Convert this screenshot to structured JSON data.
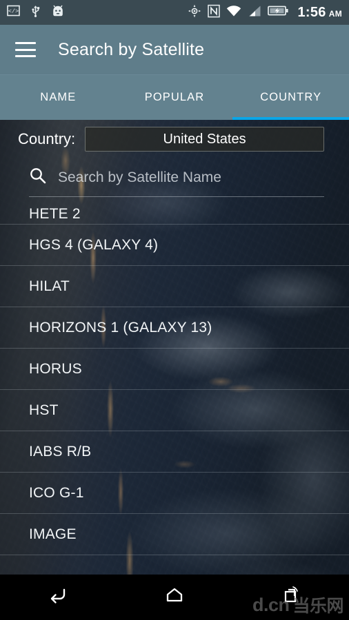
{
  "status_bar": {
    "time": "1:56",
    "ampm": "AM",
    "icons": [
      "developer-mode-icon",
      "usb-icon",
      "android-head-icon",
      "gps-location-icon",
      "nfc-icon",
      "wifi-icon",
      "cell-signal-icon",
      "battery-charging-icon"
    ],
    "background_color": "#3a4a52"
  },
  "appbar": {
    "menu_icon": "hamburger-menu-icon",
    "title": "Search by Satellite",
    "background_color": "#5f7d8a"
  },
  "tabs": {
    "selected_index": 2,
    "indicator_color": "#09a6e8",
    "background_color": "#63828f",
    "items": [
      {
        "label": "NAME"
      },
      {
        "label": "POPULAR"
      },
      {
        "label": "COUNTRY"
      }
    ]
  },
  "filter": {
    "country_label": "Country:",
    "country_value": "United States"
  },
  "search": {
    "icon": "search-icon",
    "placeholder": "Search by Satellite Name",
    "value": ""
  },
  "satellite_list": {
    "items": [
      {
        "name": "HETE 2",
        "clipped": true
      },
      {
        "name": "HGS 4 (GALAXY 4)",
        "clipped": false
      },
      {
        "name": "HILAT",
        "clipped": false
      },
      {
        "name": "HORIZONS 1 (GALAXY 13)",
        "clipped": false
      },
      {
        "name": "HORUS",
        "clipped": false
      },
      {
        "name": "HST",
        "clipped": false
      },
      {
        "name": "IABS R/B",
        "clipped": false
      },
      {
        "name": "ICO G-1",
        "clipped": false
      },
      {
        "name": "IMAGE",
        "clipped": false
      }
    ]
  },
  "navbar": {
    "back_icon": "back-arrow-icon",
    "home_icon": "home-icon",
    "recents_icon": "recent-apps-icon",
    "watermark_text": "d.cn",
    "watermark_cn": "当乐网",
    "background_color": "#000000"
  }
}
